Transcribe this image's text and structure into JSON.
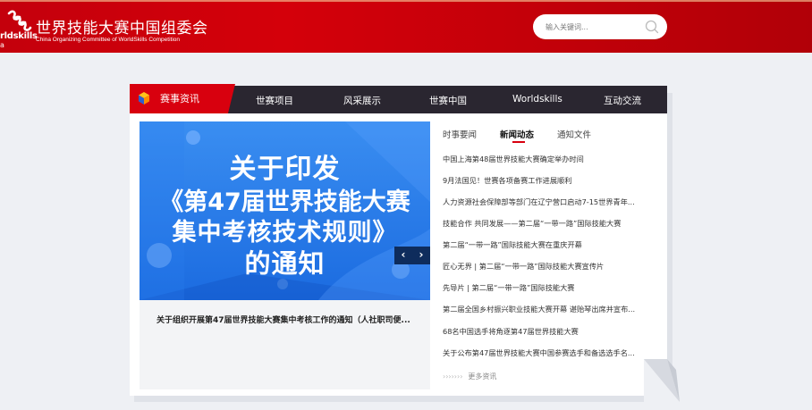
{
  "header": {
    "title": "世界技能大赛中国组委会",
    "subtitle": "China Organizing Committee of WorldSkills Competition",
    "logo_text_1": "rldskills",
    "logo_text_2": "a",
    "search_placeholder": "输入关键词..."
  },
  "nav": {
    "active": "赛事资讯",
    "items": [
      "世赛项目",
      "风采展示",
      "世赛中国",
      "Worldskills",
      "互动交流"
    ]
  },
  "banner": {
    "lines": [
      "关于印发",
      "《第47届世界技能大赛",
      "集中考核技术规则》",
      "的通知"
    ],
    "caption": "关于组织开展第47届世界技能大赛集中考核工作的通知（人社职司便..."
  },
  "tabs": [
    "时事要闻",
    "新闻动态",
    "通知文件"
  ],
  "active_tab": 1,
  "news": [
    "中国上海第48届世界技能大赛确定举办时间",
    "9月法国见！世赛各项备赛工作进展顺利",
    "人力资源社会保障部等部门在辽宁营口启动7-15世界青年...",
    "技能合作 共同发展——第二届“一带一路”国际技能大赛",
    "第二届“一带一路”国际技能大赛在重庆开幕",
    "匠心无界 | 第二届“一带一路”国际技能大赛宣传片",
    "先导片 | 第二届“一带一路”国际技能大赛",
    "第二届全国乡村振兴职业技能大赛开幕 谌贻琴出席并宣布...",
    "68名中国选手将角逐第47届世界技能大赛",
    "关于公布第47届世界技能大赛中国参赛选手和备选选手名..."
  ],
  "more_label": "更多资讯",
  "colors": {
    "brand_red": "#d8000e",
    "nav_dark": "#2a2630",
    "banner_blue": "#2a7ee8"
  }
}
